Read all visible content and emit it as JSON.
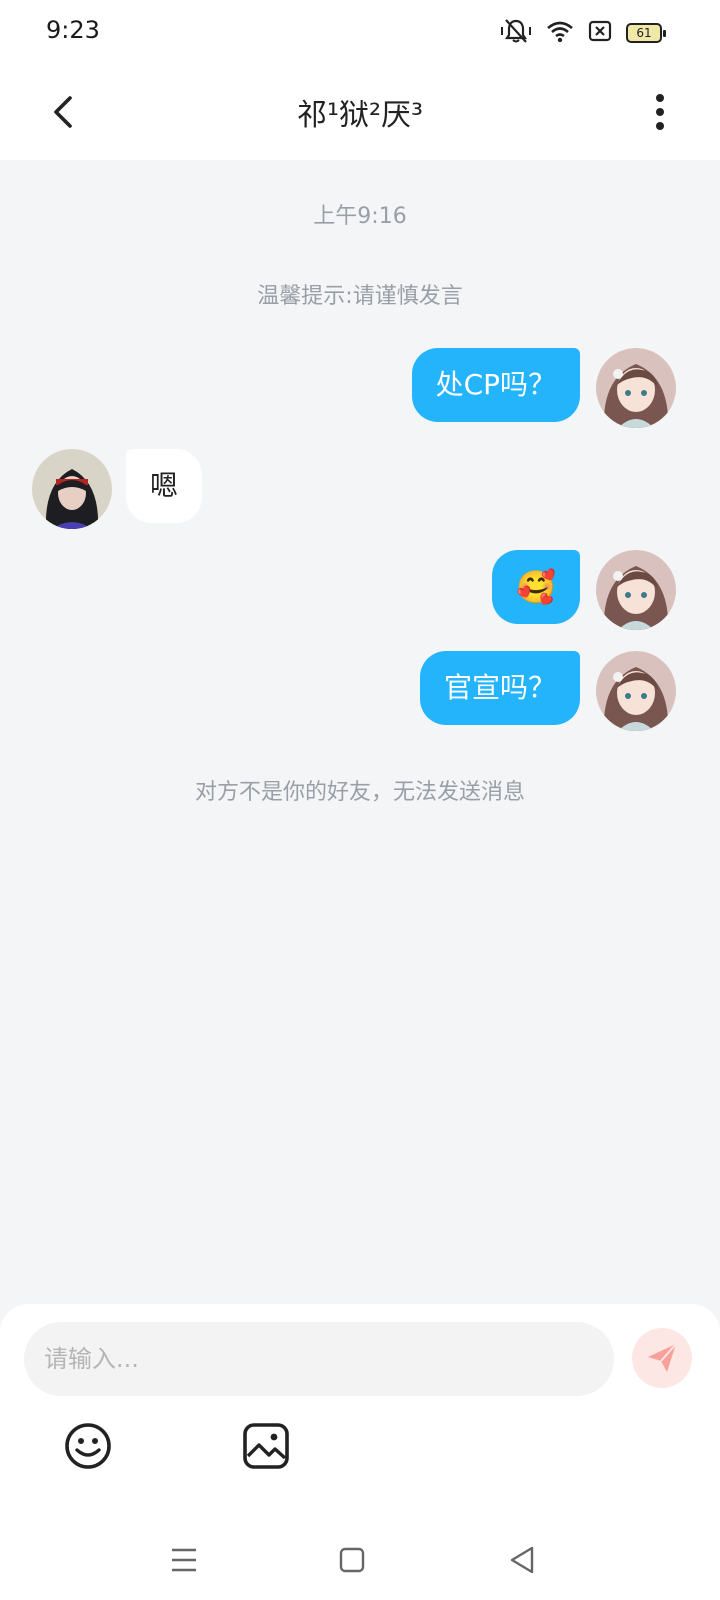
{
  "status_bar": {
    "time": "9:23",
    "battery": "61",
    "icons": [
      "mute-vibrate-icon",
      "wifi-icon",
      "sim-none-icon",
      "battery-icon"
    ]
  },
  "header": {
    "title": "祁¹狱²厌³",
    "back_icon": "chevron-left-icon",
    "more_icon": "more-vertical-icon"
  },
  "chat": {
    "timestamp": "上午9:16",
    "tip": "温馨提示:请谨慎发言",
    "messages": [
      {
        "side": "right",
        "text": "处CP吗？"
      },
      {
        "side": "left",
        "text": "嗯"
      },
      {
        "side": "right",
        "text": "🥰"
      },
      {
        "side": "right",
        "text": "官宣吗？"
      }
    ],
    "notice": "对方不是你的好友，无法发送消息"
  },
  "input": {
    "placeholder": "请输入...",
    "send_icon": "paper-plane-icon",
    "tools": [
      "emoji-icon",
      "image-icon"
    ]
  },
  "nav": {
    "icons": [
      "menu-icon",
      "home-icon",
      "back-icon"
    ]
  },
  "colors": {
    "accent": "#23b4fb",
    "background": "#f4f5f7",
    "send_button": "#fde7e5",
    "send_icon": "#f7a19a"
  }
}
